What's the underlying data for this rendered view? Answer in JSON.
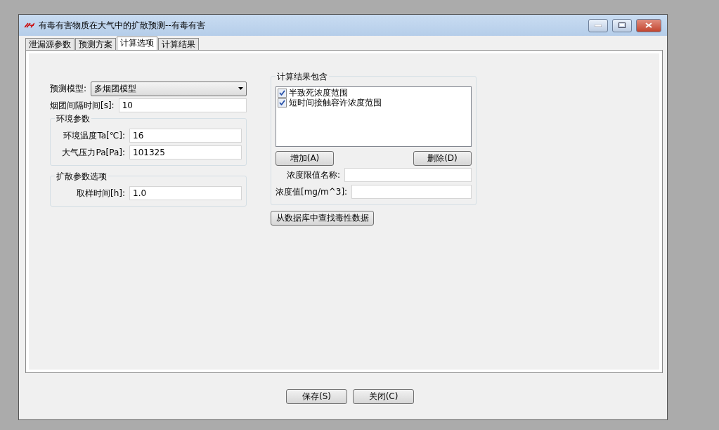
{
  "window": {
    "title": "有毒有害物质在大气中的扩散预测--有毒有害"
  },
  "tabs": [
    {
      "label": "泄漏源参数",
      "selected": false
    },
    {
      "label": "预测方案",
      "selected": false
    },
    {
      "label": "计算选项",
      "selected": true
    },
    {
      "label": "计算结果",
      "selected": false
    }
  ],
  "model": {
    "label": "预测模型:",
    "value": "多烟团模型"
  },
  "interval": {
    "label": "烟团间隔时间[s]:",
    "value": "10"
  },
  "environment": {
    "title": "环境参数",
    "fields": [
      {
        "label": "环境温度Ta[℃]:",
        "value": "16"
      },
      {
        "label": "大气压力Pa[Pa]:",
        "value": "101325"
      }
    ]
  },
  "diffusion": {
    "title": "扩散参数选项",
    "fields": [
      {
        "label": "取样时间[h]:",
        "value": "1.0"
      }
    ]
  },
  "results": {
    "title": "计算结果包含",
    "items": [
      {
        "label": "半致死浓度范围",
        "checked": true
      },
      {
        "label": "短时间接触容许浓度范围",
        "checked": true
      }
    ],
    "add_button": "增加(A)",
    "delete_button": "删除(D)",
    "fields": [
      {
        "label": "浓度限值名称:"
      },
      {
        "label": "浓度值[mg/m^3]:"
      }
    ]
  },
  "lookup_button": "从数据库中查找毒性数据",
  "footer_buttons": [
    "保存(S)",
    "关闭(C)"
  ]
}
